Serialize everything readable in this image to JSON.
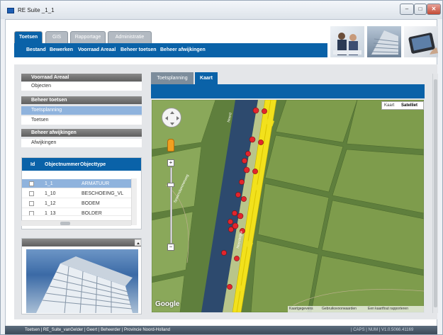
{
  "window": {
    "title": "RE Suite _1_1",
    "minimize": "–",
    "maximize": "□",
    "close": "✕"
  },
  "main_tabs": [
    {
      "label": "Toetsen"
    },
    {
      "label": "GIS"
    },
    {
      "label": "Rapportage"
    },
    {
      "label": "Administratie"
    }
  ],
  "menu": [
    "Bestand",
    "Bewerken",
    "Voorraad Areaal",
    "Beheer toetsen",
    "Beheer afwijkingen"
  ],
  "sidebar": {
    "sections": [
      {
        "header": "Voorraad Areaal",
        "items": [
          "Objecten"
        ]
      },
      {
        "header": "Beheer toetsen",
        "items": [
          "Toetsplanning",
          "Toetsen"
        ]
      },
      {
        "header": "Beheer afwijkingen",
        "items": [
          "Afwijkingen"
        ]
      }
    ]
  },
  "grid": {
    "columns": [
      "Id",
      "Objectnummer",
      "Objecttype"
    ],
    "rows": [
      {
        "num": "1_1",
        "type": "ARMATUUR"
      },
      {
        "num": "1_10",
        "type": "BESCHOEING_VL"
      },
      {
        "num": "1_12",
        "type": "BODEM"
      },
      {
        "num": "1_13",
        "type": "BOLDER"
      }
    ]
  },
  "map": {
    "tabs": [
      "Toetsplanning",
      "Kaart"
    ],
    "type_buttons": [
      "Kaart",
      "Satelliet"
    ],
    "footer": [
      "Kaartgegevens",
      "Gebruiksvoorwaarden",
      "Een kaartfout rapporteren"
    ],
    "google": "Google",
    "zoom_in": "+",
    "zoom_out": "−",
    "road_labels": [
      "Spaarndammerweg",
      "Noord",
      "Noordelijke"
    ]
  },
  "status": {
    "left": "Toetsen | RE_Suite_vanGelder | Geert | Beheerder | Provincie Noord-Holland",
    "right": "| CAPS | NUM | V1.0.5066.41169"
  },
  "colors": {
    "primary": "#0a62a8",
    "selected": "#8fb3dd",
    "marker": "#e2252c",
    "road": "#f2e11c"
  }
}
